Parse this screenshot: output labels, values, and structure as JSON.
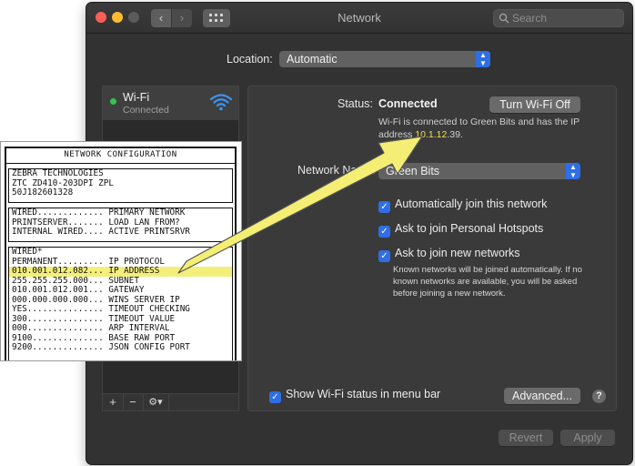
{
  "window": {
    "title": "Network",
    "search_placeholder": "Search",
    "nav_back": "‹",
    "nav_forward": "›"
  },
  "location": {
    "label": "Location:",
    "value": "Automatic"
  },
  "sidebar": {
    "services": [
      {
        "name": "Wi-Fi",
        "status": "Connected",
        "status_color": "#35c44a",
        "icon": "wifi-icon"
      }
    ],
    "add_label": "+",
    "remove_label": "−",
    "gear_label": "⚙▾"
  },
  "wifi_panel": {
    "status_label": "Status:",
    "status_value": "Connected",
    "turn_off_label": "Turn Wi-Fi Off",
    "status_desc_prefix": "Wi-Fi is connected to Green Bits and has the IP address ",
    "status_ip": "10.1.12",
    "status_desc_suffix": ".39.",
    "network_name_label": "Network Name:",
    "network_name_value": "Green Bits",
    "options": [
      {
        "label": "Automatically join this network",
        "checked": true
      },
      {
        "label": "Ask to join Personal Hotspots",
        "checked": true
      },
      {
        "label": "Ask to join new networks",
        "checked": true
      }
    ],
    "options_note": "Known networks will be joined automatically. If no known networks are available, you will be asked before joining a new network.",
    "show_status_label": "Show Wi-Fi status in menu bar",
    "advanced_label": "Advanced...",
    "help_label": "?",
    "revert_label": "Revert",
    "apply_label": "Apply"
  },
  "printout": {
    "title": "NETWORK CONFIGURATION",
    "header_lines": [
      "ZEBRA TECHNOLOGIES",
      "ZTC ZD410-203DPI ZPL",
      "50J182601328"
    ],
    "primary_lines": [
      "WIRED............. PRIMARY NETWORK",
      "PRINTSERVER....... LOAD LAN FROM?",
      "INTERNAL WIRED.... ACTIVE PRINTSRVR"
    ],
    "wired_lines": [
      "WIRED*",
      "PERMANENT......... IP PROTOCOL",
      "010.001.012.082... IP ADDRESS",
      "255.255.255.000... SUBNET",
      "010.001.012.001... GATEWAY",
      "000.000.000.000... WINS SERVER IP",
      "YES............... TIMEOUT CHECKING",
      "300............... TIMEOUT VALUE",
      "000............... ARP INTERVAL",
      "9100.............. BASE RAW PORT",
      "9200.............. JSON CONFIG PORT"
    ],
    "highlight_index": 2,
    "highlight_color": "#f3ef7a"
  },
  "colors": {
    "accent": "#2f6ee5",
    "window_bg": "#323232",
    "arrow_fill": "#f4ee74",
    "ip_highlight": "#f2e14c"
  }
}
